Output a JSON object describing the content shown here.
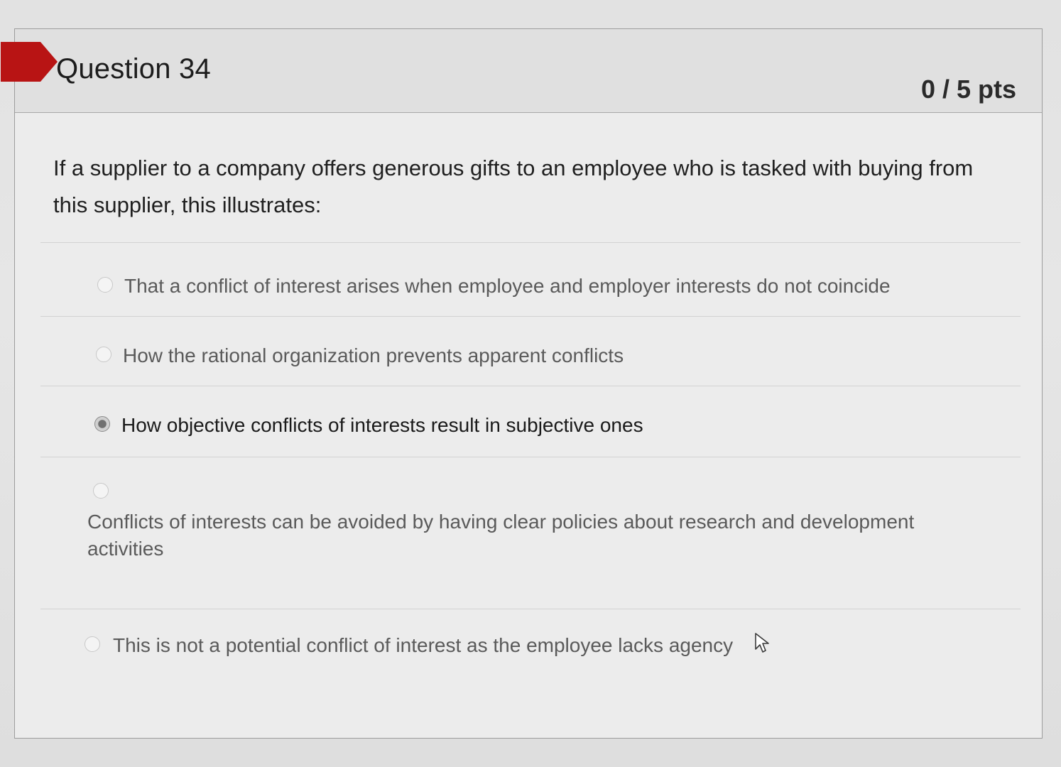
{
  "question": {
    "title": "Question 34",
    "points": "0 / 5 pts",
    "text": "If a supplier to a company offers generous gifts to an employee who is tasked with buying from this supplier, this illustrates:"
  },
  "answers": [
    {
      "label": "That a conflict of interest arises when employee and employer interests do not coincide",
      "selected": false
    },
    {
      "label": "How the rational organization prevents apparent conflicts",
      "selected": false
    },
    {
      "label": "How objective conflicts of interests result in subjective ones",
      "selected": true
    },
    {
      "label": "Conflicts of interests can be avoided by having clear policies about research and development activities",
      "selected": false
    },
    {
      "label": "This is not a potential conflict of interest as the employee lacks agency",
      "selected": false
    }
  ],
  "colors": {
    "flag": "#b81414",
    "header_bg": "#e0e0e0",
    "card_bg": "#ececec"
  },
  "icons": {
    "cursor": "mouse-pointer-icon",
    "flag": "flag-marker"
  }
}
